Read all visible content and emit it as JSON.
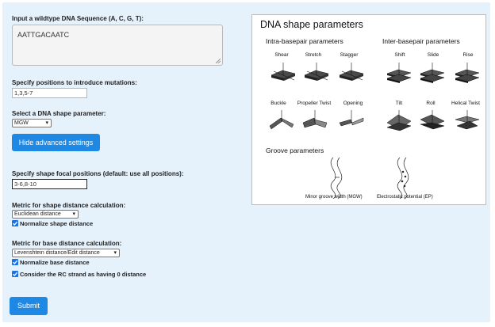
{
  "form": {
    "seq_label": "Input a wildtype DNA Sequence (A, C, G, T):",
    "seq_value": "AATTGACAATC",
    "mut_label": "Specify positions to introduce mutations:",
    "mut_value": "1,3,5-7",
    "shape_label": "Select a DNA shape parameter:",
    "shape_value": "MGW",
    "advanced_button": "Hide advanced settings",
    "focal_label": "Specify shape focal positions (default: use all positions):",
    "focal_value": "3-6,8-10",
    "shape_metric_label": "Metric for shape distance calculation:",
    "shape_metric_value": "Euclidean distance",
    "normalize_shape": "Normalize shape distance",
    "base_metric_label": "Metric for base distance calculation:",
    "base_metric_value": "Levenshtein distance/Edit distance",
    "normalize_base": "Normalize base distance",
    "rc_zero": "Consider the RC strand as having 0 distance",
    "submit": "Submit"
  },
  "figure": {
    "title": "DNA shape parameters",
    "intra_title": "Intra-basepair parameters",
    "inter_title": "Inter-basepair parameters",
    "groove_title": "Groove parameters",
    "intra_row1": [
      "Shear",
      "Stretch",
      "Stagger"
    ],
    "intra_row2": [
      "Buckle",
      "Propeller Twist",
      "Opening"
    ],
    "inter_row1": [
      "Shift",
      "Slide",
      "Rise"
    ],
    "inter_row2": [
      "Tilt",
      "Roll",
      "Helical Twist"
    ],
    "groove_labels": [
      "Minor groove width (MGW)",
      "Electrostatic potential (EP)"
    ]
  },
  "colors": {
    "panel_bg": "#e5f1fb",
    "button_blue": "#1e88e5",
    "checkbox_blue": "#1a73e8"
  }
}
